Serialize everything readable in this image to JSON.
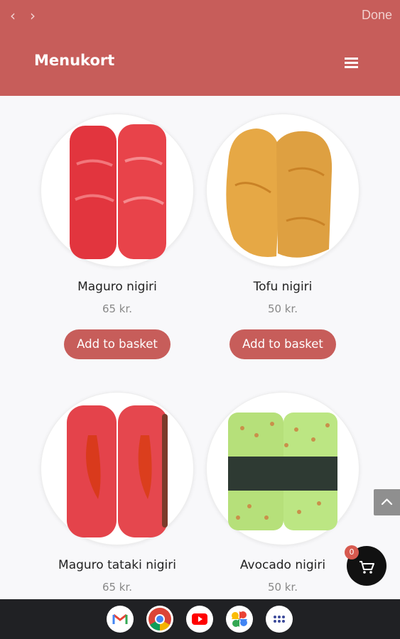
{
  "browser": {
    "back_icon": "chevron-left-icon",
    "forward_icon": "chevron-right-icon",
    "done_label": "Done"
  },
  "header": {
    "title": "Menukort",
    "menu_icon": "hamburger-icon",
    "background": "#c75d5a"
  },
  "products": [
    {
      "name": "Maguro nigiri",
      "price": "65 kr.",
      "button": "Add to basket"
    },
    {
      "name": "Tofu nigiri",
      "price": "50 kr.",
      "button": "Add to basket"
    },
    {
      "name": "Maguro tataki nigiri",
      "price": "65 kr."
    },
    {
      "name": "Avocado nigiri",
      "price": "50 kr."
    }
  ],
  "cart": {
    "count": "0",
    "icon": "cart-icon"
  },
  "scroll_top_icon": "chevron-up-icon",
  "dock": {
    "apps": [
      "gmail-icon",
      "chrome-icon",
      "youtube-icon",
      "photos-icon",
      "app-drawer-icon"
    ]
  }
}
